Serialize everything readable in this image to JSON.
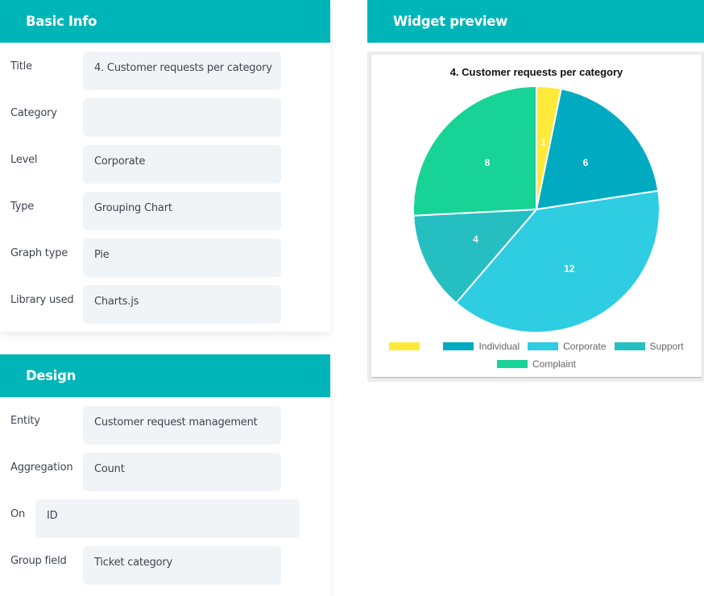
{
  "basic_info": {
    "header": "Basic Info",
    "fields": [
      {
        "label": "Title",
        "value": "4. Customer requests per category"
      },
      {
        "label": "Category",
        "value": ""
      },
      {
        "label": "Level",
        "value": "Corporate"
      },
      {
        "label": "Type",
        "value": "Grouping Chart"
      },
      {
        "label": "Graph type",
        "value": "Pie"
      },
      {
        "label": "Library used",
        "value": "Charts.js"
      }
    ]
  },
  "design": {
    "header": "Design",
    "fields": [
      {
        "label": "Entity",
        "value": "Customer request management"
      },
      {
        "label": "Aggregation",
        "value": "Count"
      },
      {
        "label": "On",
        "value": "ID"
      },
      {
        "label": "Group field",
        "value": "Ticket category"
      }
    ]
  },
  "widget_preview": {
    "header": "Widget preview"
  },
  "chart_data": {
    "type": "pie",
    "title": "4. Customer requests per category",
    "categories": [
      "",
      "Individual",
      "Corporate",
      "Support",
      "Complaint"
    ],
    "values": [
      1,
      6,
      12,
      4,
      8
    ],
    "colors": [
      "#ffe93b",
      "#00abc1",
      "#2ecde2",
      "#25bfc2",
      "#18d396"
    ],
    "data_labels": [
      "1",
      "6",
      "12",
      "4",
      "8"
    ],
    "legend_position": "bottom"
  }
}
